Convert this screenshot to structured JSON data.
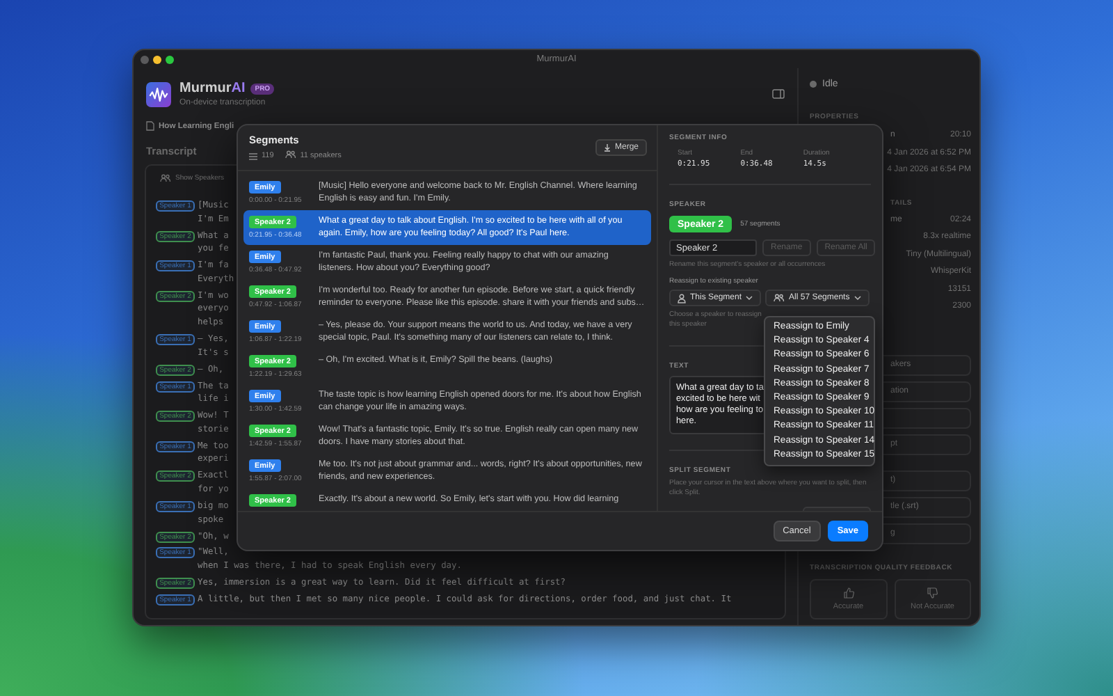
{
  "window": {
    "title": "MurmurAI"
  },
  "app": {
    "name": "Murmur",
    "name_accent": "AI",
    "badge": "PRO",
    "subtitle": "On-device transcription"
  },
  "document": {
    "title": "How Learning Engli"
  },
  "transcript": {
    "heading": "Transcript",
    "show_speakers_label": "Show Speakers",
    "lines": [
      {
        "speaker": "Speaker 1",
        "color": "#3a6fb5",
        "text": [
          "[Music",
          "I'm Em"
        ]
      },
      {
        "speaker": "Speaker 2",
        "color": "#3f8f4e",
        "text": [
          "What a",
          "you fe"
        ]
      },
      {
        "speaker": "Speaker 1",
        "color": "#3a6fb5",
        "text": [
          "I'm fa",
          "Everyth"
        ]
      },
      {
        "speaker": "Speaker 2",
        "color": "#3f8f4e",
        "text": [
          "I'm wo",
          "everyo",
          "helps"
        ]
      },
      {
        "speaker": "Speaker 1",
        "color": "#3a6fb5",
        "text": [
          "– Yes,",
          "It's s"
        ]
      },
      {
        "speaker": "Speaker 2",
        "color": "#3f8f4e",
        "text": [
          "— Oh,"
        ]
      },
      {
        "speaker": "Speaker 1",
        "color": "#3a6fb5",
        "text": [
          "The ta",
          "life i"
        ]
      },
      {
        "speaker": "Speaker 2",
        "color": "#3f8f4e",
        "text": [
          "Wow! T",
          "storie"
        ]
      },
      {
        "speaker": "Speaker 1",
        "color": "#3a6fb5",
        "text": [
          "Me too",
          "experi"
        ]
      },
      {
        "speaker": "Speaker 2",
        "color": "#3f8f4e",
        "text": [
          "Exactl",
          "for yo"
        ]
      },
      {
        "speaker": "Speaker 1",
        "color": "#3a6fb5",
        "text": [
          "big mo",
          "spoke"
        ]
      },
      {
        "speaker": "Speaker 2",
        "color": "#3f8f4e",
        "text": [
          "\"Oh, w"
        ]
      },
      {
        "speaker": "Speaker 1",
        "color": "#3a6fb5",
        "text": [
          "\"Well,",
          "when I was there, I had to speak English every day."
        ]
      },
      {
        "speaker": "Speaker 2",
        "color": "#3f8f4e",
        "text": [
          "Yes, immersion is a great way to learn. Did it feel difficult at first?"
        ]
      },
      {
        "speaker": "Speaker 1",
        "color": "#3a6fb5",
        "text": [
          "A little, but then I met so many nice people. I could ask for directions, order food, and just chat. It"
        ]
      }
    ]
  },
  "sidebar": {
    "status": "Idle",
    "properties": {
      "heading": "PROPERTIES",
      "rows": [
        {
          "label": "n",
          "value": "20:10"
        },
        {
          "value": "4 Jan 2026 at 6:52 PM"
        },
        {
          "value": "4 Jan 2026 at 6:54 PM"
        }
      ]
    },
    "details": {
      "heading": "TAILS",
      "rows": [
        {
          "label": "me",
          "value": "02:24"
        },
        {
          "value": "8.3x realtime"
        },
        {
          "value": "Tiny (Multilingual)"
        },
        {
          "value": "WhisperKit"
        },
        {
          "value": "13151"
        },
        {
          "value": "2300"
        }
      ]
    },
    "action_groups": [
      [
        {
          "kind": "button",
          "label": "akers"
        },
        {
          "kind": "button",
          "label": "ation"
        },
        {
          "kind": "button"
        },
        {
          "kind": "button",
          "label": "pt"
        }
      ],
      [
        {
          "kind": "button",
          "label": "t)"
        },
        {
          "kind": "button",
          "label": "tle (.srt)"
        },
        {
          "kind": "button",
          "label": "g"
        }
      ]
    ],
    "feedback": {
      "heading": "TRANSCRIPTION QUALITY FEEDBACK",
      "buttons": [
        {
          "kind": "up",
          "label": "Accurate"
        },
        {
          "kind": "down",
          "label": "Not Accurate"
        }
      ]
    }
  },
  "modal": {
    "segments": {
      "heading": "Segments",
      "count": "119",
      "speakers": "11 speakers",
      "merge_label": "Merge",
      "rows": [
        {
          "speaker": "Emily",
          "color": "#2f80ed",
          "time": "0:00.00 - 0:21.95",
          "text": "[Music] Hello everyone and welcome back to Mr. English Channel. Where learning English is easy and fun. I'm Emily.",
          "selected": false
        },
        {
          "speaker": "Speaker 2",
          "color": "#30c048",
          "time": "0:21.95 - 0:36.48",
          "text": "What a great day to talk about English. I'm so excited to be here with all of you again. Emily, how are you feeling today? All good? It's Paul here.",
          "selected": true
        },
        {
          "speaker": "Emily",
          "color": "#2f80ed",
          "time": "0:36.48 - 0:47.92",
          "text": "I'm fantastic Paul, thank you. Feeling really happy to chat with our amazing listeners. How about you? Everything good?",
          "selected": false
        },
        {
          "speaker": "Speaker 2",
          "color": "#30c048",
          "time": "0:47.92 - 1:06.87",
          "text": "I'm wonderful too. Ready for another fun episode. Before we start, a quick friendly reminder to everyone. Please like this episode. share it with your friends and subs…",
          "selected": false
        },
        {
          "speaker": "Emily",
          "color": "#2f80ed",
          "time": "1:06.87 - 1:22.19",
          "text": "– Yes, please do. Your support means the world to us. And today, we have a very special topic, Paul. It's something many of our listeners can relate to, I think.",
          "selected": false
        },
        {
          "speaker": "Speaker 2",
          "color": "#30c048",
          "time": "1:22.19 - 1:29.63",
          "text": "– Oh, I'm excited. What is it, Emily? Spill the beans. (laughs)",
          "selected": false
        },
        {
          "speaker": "Emily",
          "color": "#2f80ed",
          "time": "1:30.00 - 1:42.59",
          "text": "The taste topic is how learning English opened doors for me. It's about how English can change your life in amazing ways.",
          "selected": false
        },
        {
          "speaker": "Speaker 2",
          "color": "#30c048",
          "time": "1:42.59 - 1:55.87",
          "text": "Wow! That's a fantastic topic, Emily. It's so true. English really can open many new doors. I have many stories about that.",
          "selected": false
        },
        {
          "speaker": "Emily",
          "color": "#2f80ed",
          "time": "1:55.87 - 2:07.00",
          "text": "Me too. It's not just about grammar and... words, right? It's about opportunities, new friends, and new experiences.",
          "selected": false
        },
        {
          "speaker": "Speaker 2",
          "color": "#30c048",
          "text": "Exactly. It's about a new world. So Emily, let's start with you. How did learning",
          "selected": false
        }
      ]
    },
    "info": {
      "heading": "SEGMENT INFO",
      "fields": [
        {
          "label": "Start",
          "value": "0:21.95"
        },
        {
          "label": "End",
          "value": "0:36.48"
        },
        {
          "label": "Duration",
          "value": "14.5s"
        }
      ]
    },
    "speaker": {
      "heading": "SPEAKER",
      "name": "Speaker 2",
      "color": "#30c048",
      "count": "57 segments",
      "name_field": "Speaker 2",
      "rename": {
        "label": "Rename",
        "disabled": true
      },
      "rename_all": {
        "label": "Rename All",
        "disabled": true
      },
      "rename_hint": "Rename this segment's speaker or all occurrences",
      "reassign_heading": "Reassign to existing speaker",
      "this_segment": "This Segment",
      "all_segments": "All 57 Segments",
      "reassign_hint": [
        "Choose a speaker to reassign",
        "this speaker"
      ]
    },
    "menu": {
      "items": [
        "Reassign to Emily",
        "Reassign to Speaker 4",
        "Reassign to Speaker 6",
        "Reassign to Speaker 7",
        "Reassign to Speaker 8",
        "Reassign to Speaker 9",
        "Reassign to Speaker 10",
        "Reassign to Speaker 11",
        "Reassign to Speaker 14",
        "Reassign to Speaker 15"
      ]
    },
    "text": {
      "heading": "TEXT",
      "lines": [
        "What a great day to ta",
        "excited to be here wit",
        "how are you feeling to",
        "here."
      ]
    },
    "split": {
      "heading": "SPLIT SEGMENT",
      "hint": "Place your cursor in the text above where you want to split, then click Split."
    },
    "footer": {
      "cancel": "Cancel",
      "save": "Save"
    }
  }
}
